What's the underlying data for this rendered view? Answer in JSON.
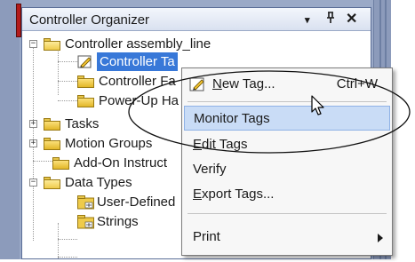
{
  "panel": {
    "title": "Controller Organizer",
    "dropdown_glyph": "▾",
    "pin_glyph": "ᵖ",
    "close_glyph": "✕"
  },
  "tree": {
    "root_label": "Controller assembly_line",
    "controller_tags_label": "Controller Ta",
    "controller_faults_label": "Controller Fa",
    "powerup_label": "Power-Up Ha",
    "tasks_label": "Tasks",
    "motion_groups_label": "Motion Groups",
    "addon_label": "Add-On Instruct",
    "data_types_label": "Data Types",
    "user_defined_label": "User-Defined",
    "strings_label": "Strings",
    "expander_plus": "+",
    "expander_minus": "−"
  },
  "context_menu": {
    "new_tag_prefix": "N",
    "new_tag_rest": "ew Tag...",
    "new_tag_shortcut": "Ctrl+W",
    "monitor_tags": "Monitor Tags",
    "edit_tags_prefix": "E",
    "edit_tags_rest": "dit Tags",
    "verify": "Verify",
    "export_tags_prefix": "E",
    "export_tags_rest": "xport Tags...",
    "print": "Print"
  },
  "colors": {
    "selection": "#3878d8",
    "menu_highlight": "#c9dcf6",
    "folder": "#e2b729"
  },
  "icons": [
    "pencil-icon",
    "folder-icon",
    "udt-icon",
    "mouse-cursor-icon"
  ]
}
